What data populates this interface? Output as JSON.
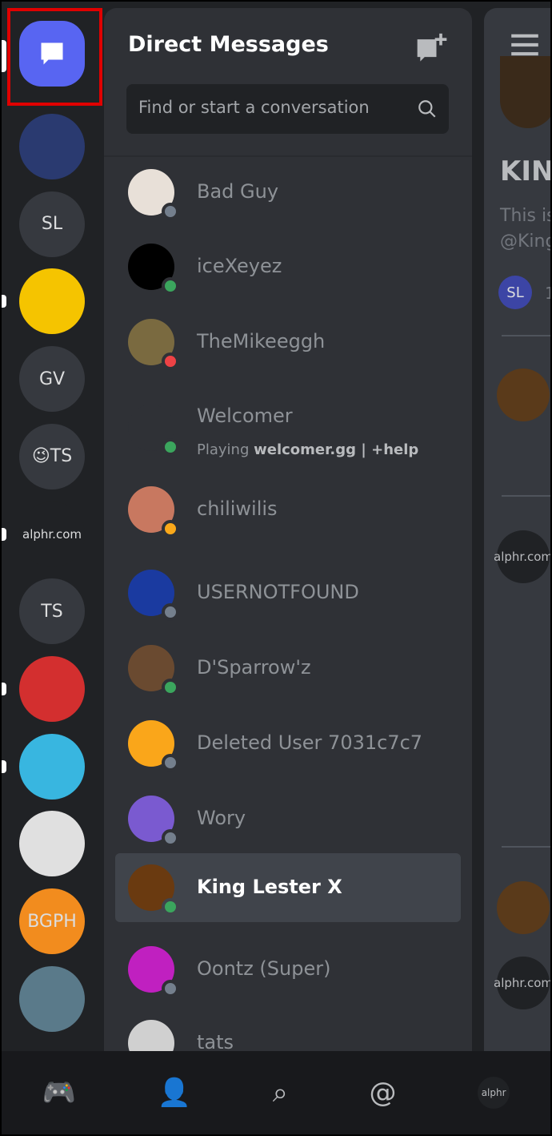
{
  "rail": {
    "dm_icon": "chat-bubble-icon",
    "servers": [
      {
        "label": "",
        "color": "#2a3a70",
        "pill": false
      },
      {
        "label": "SL",
        "color": "#36393f",
        "pill": false
      },
      {
        "label": "",
        "color": "#f5c400",
        "pill": true
      },
      {
        "label": "GV",
        "color": "#36393f",
        "pill": false
      },
      {
        "label": "😉TS",
        "color": "#36393f",
        "pill": false
      },
      {
        "label": "alphr.com",
        "color": "#202225",
        "pill": true
      },
      {
        "label": "TS",
        "color": "#36393f",
        "pill": false
      },
      {
        "label": "",
        "color": "#d32f2f",
        "pill": true
      },
      {
        "label": "",
        "color": "#38b6e0",
        "pill": true
      },
      {
        "label": "",
        "color": "#e0e0e0",
        "pill": false
      },
      {
        "label": "BGPH",
        "color": "#f28c1e",
        "pill": false
      },
      {
        "label": "",
        "color": "#5a7a8a",
        "pill": false
      }
    ]
  },
  "panel": {
    "title": "Direct Messages",
    "search_placeholder": "Find or start a conversation",
    "dms": [
      {
        "name": "Bad Guy",
        "status": "offline",
        "avatar": "#e8e0d8"
      },
      {
        "name": "iceXeyez",
        "status": "online",
        "avatar": "#000000"
      },
      {
        "name": "TheMikeeggh",
        "status": "dnd",
        "avatar": "#7a6a40"
      },
      {
        "name": "Welcomer",
        "status": "online",
        "avatar": "#2f3136",
        "activity_prefix": "Playing ",
        "activity": "welcomer.gg | +help"
      },
      {
        "name": "chiliwilis",
        "status": "idle",
        "avatar": "#c87860"
      },
      {
        "name": "USERNOTFOUND",
        "status": "offline",
        "avatar": "#1a3aa0"
      },
      {
        "name": "D'Sparrow'z",
        "status": "online",
        "avatar": "#6a4a30"
      },
      {
        "name": "Deleted User 7031c7c7",
        "status": "offline",
        "avatar": "#faa61a"
      },
      {
        "name": "Wory",
        "status": "offline",
        "avatar": "#7a5ad0"
      },
      {
        "name": "King Lester X",
        "status": "online",
        "avatar": "#6a3a10",
        "selected": true
      },
      {
        "name": "Oontz (Super)",
        "status": "offline",
        "avatar": "#c020c0"
      },
      {
        "name": "tats",
        "status": "offline",
        "avatar": "#d0d0d0"
      }
    ]
  },
  "right": {
    "title": "KIN",
    "desc1": "This is",
    "desc2": "@King",
    "member": "SL",
    "count": "1",
    "alphr": "alphr.com"
  },
  "status_colors": {
    "online": "#3ba55d",
    "offline": "#747f8d",
    "dnd": "#ed4245",
    "idle": "#faa81a"
  },
  "bottom_tabs": [
    "home-icon",
    "friends-icon",
    "search-icon",
    "mentions-icon",
    "profile-icon"
  ]
}
